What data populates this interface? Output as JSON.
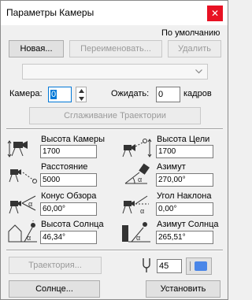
{
  "window": {
    "title": "Параметры Камеры",
    "close_symbol": "✕"
  },
  "preset": {
    "default_label": "По умолчанию",
    "new_button": "Новая...",
    "rename_button": "Переименовать...",
    "delete_button": "Удалить",
    "dropdown_value": ""
  },
  "camera": {
    "camera_label": "Камера:",
    "camera_value": "0",
    "wait_label": "Ожидать:",
    "wait_value": "0",
    "frames_label": "кадров",
    "smooth_button": "Сглаживание Траектории"
  },
  "params": {
    "camera_height_label": "Высота Камеры",
    "camera_height_value": "1700",
    "target_height_label": "Высота Цели",
    "target_height_value": "1700",
    "distance_label": "Расстояние",
    "distance_value": "5000",
    "azimuth_label": "Азимут",
    "azimuth_value": "270,00°",
    "view_cone_label": "Конус Обзора",
    "view_cone_value": "60,00°",
    "tilt_label": "Угол Наклона",
    "tilt_value": "0,00°",
    "sun_height_label": "Высота Солнца",
    "sun_height_value": "46,34°",
    "sun_azimuth_label": "Азимут Солнца",
    "sun_azimuth_value": "265,51°"
  },
  "footer": {
    "path_button": "Траектория...",
    "pen_value": "45",
    "sun_button": "Солнце...",
    "set_button": "Установить"
  },
  "colors": {
    "pen_swatch": "#4a86e8",
    "close_bg": "#e81123",
    "focus": "#0078d7"
  }
}
